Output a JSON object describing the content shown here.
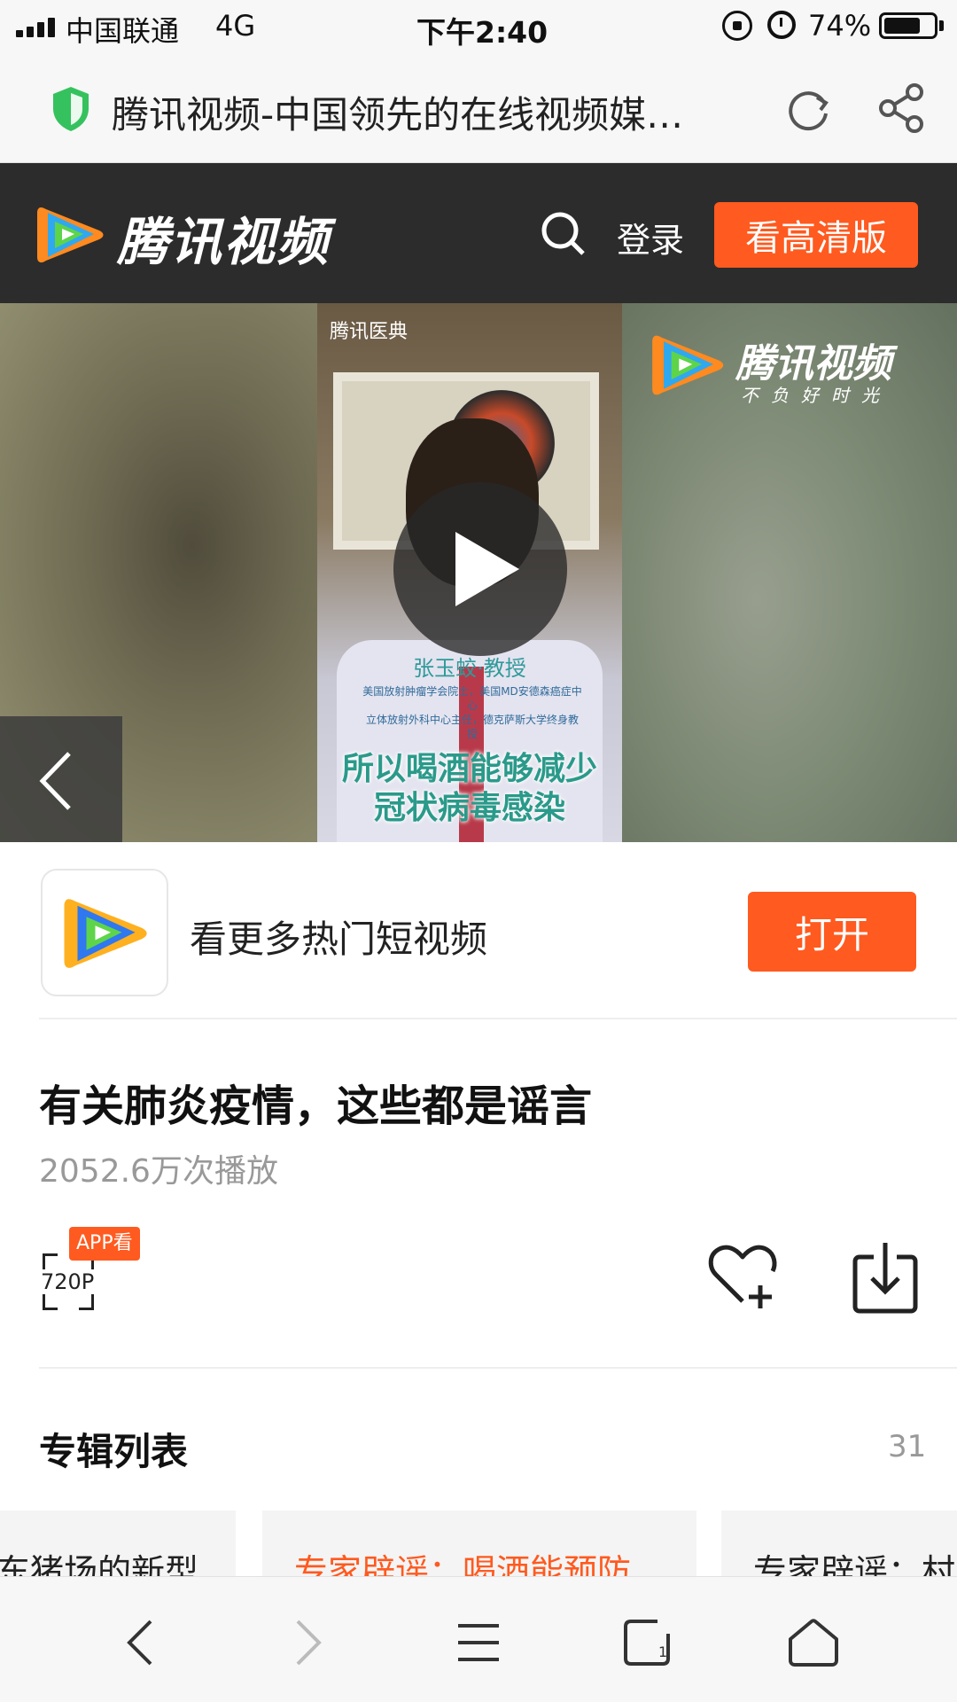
{
  "status_bar": {
    "carrier": "中国联通",
    "network": "4G",
    "time": "下午2:40",
    "battery_percent": "74%",
    "battery_level": 0.74
  },
  "browser": {
    "page_title": "腾讯视频-中国领先的在线视频媒…"
  },
  "site_header": {
    "logo_text": "腾讯视频",
    "login_label": "登录",
    "hd_button_label": "看高清版"
  },
  "video": {
    "clinic_logo": "腾讯医典",
    "doctor_name": "张玉蛟·教授",
    "doctor_title_line1": "美国放射肿瘤学会院士，美国MD安德森癌症中心",
    "doctor_title_line2": "立体放射外科中心主任，德克萨斯大学终身教授",
    "caption_line1": "所以喝酒能够减少",
    "caption_line2": "冠状病毒感染",
    "watermark_text": "腾讯视频",
    "watermark_slogan": "不负好时光"
  },
  "promo": {
    "text": "看更多热门短视频",
    "open_label": "打开"
  },
  "video_info": {
    "title": "有关肺炎疫情，这些都是谣言",
    "play_count": "2052.6万次播放",
    "quality_label": "720P",
    "app_badge": "APP看"
  },
  "album": {
    "title": "专辑列表",
    "count": "31",
    "cards": [
      {
        "text": "东猪场的新型",
        "color": "#222222"
      },
      {
        "text": "专家辟谣：喝酒能预防",
        "color": "#ff5a1f"
      },
      {
        "text": "专家辟谣：村",
        "color": "#222222"
      }
    ]
  },
  "colors": {
    "accent": "#ff5a1f",
    "header_bg": "#2c2c2c"
  }
}
